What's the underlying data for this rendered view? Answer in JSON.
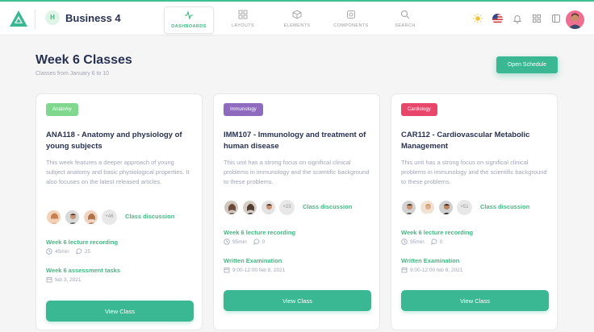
{
  "header": {
    "business_initial": "H",
    "business_name": "Business 4",
    "tabs": [
      {
        "label": "DASHBOARDS",
        "icon": "activity-icon"
      },
      {
        "label": "LAYOUTS",
        "icon": "grid-icon"
      },
      {
        "label": "ELEMENTS",
        "icon": "box-icon"
      },
      {
        "label": "COMPONENTS",
        "icon": "cog-icon"
      },
      {
        "label": "SEARCH",
        "icon": "search-icon"
      }
    ],
    "right_icons": [
      "sun-icon",
      "flag-us-icon",
      "bell-icon",
      "apps-grid-icon",
      "sidebar-icon",
      "user-avatar"
    ]
  },
  "page": {
    "title": "Week 6 Classes",
    "subtitle": "Classes from January 6 to 10",
    "open_schedule_label": "Open Schedule"
  },
  "colors": {
    "accent": "#3ab793",
    "anatomy_tag": "#7fd88d",
    "immunology_tag": "#8e6bbf",
    "cardiology_tag": "#e8466a"
  },
  "cards": [
    {
      "tag": "Anatomy",
      "title": "ANA118 - Anatomy and physiology of young subjects",
      "description": "This week features a deeper approach of young subject anatomy and basic physiological properties. It also focuses on the latest released articles.",
      "more_count": "+46",
      "discussion_label": "Class discussion",
      "item1_title": "Week 6 lecture recording",
      "item1_duration": "45min",
      "item1_comments": "25",
      "item2_title": "Week 6 assessment tasks",
      "item2_date": "feb 3, 2021",
      "button_label": "View Class"
    },
    {
      "tag": "Immunology",
      "title": "IMM107 - Immunology and treatment of human disease",
      "description": "This unit has a strong focus on significal clinical problems in immunology and the scientific background to these problems.",
      "more_count": "+23",
      "discussion_label": "Class discussion",
      "item1_title": "Week 6 lecture recording",
      "item1_duration": "95min",
      "item1_comments": "0",
      "item2_title": "Written Examination",
      "item2_date": "9:00-12:00 feb 8, 2021",
      "button_label": "View Class"
    },
    {
      "tag": "Cardiology",
      "title": "CAR112 - Cardiovascular Metabolic Management",
      "description": "This unit has a strong focus on significal clinical problems in immunology and the scientific background to these problems.",
      "more_count": "+51",
      "discussion_label": "Class discussion",
      "item1_title": "Week 6 lecture recording",
      "item1_duration": "95min",
      "item1_comments": "0",
      "item2_title": "Written Examination",
      "item2_date": "9:00-12:00 feb 8, 2021",
      "button_label": "View Class"
    }
  ]
}
